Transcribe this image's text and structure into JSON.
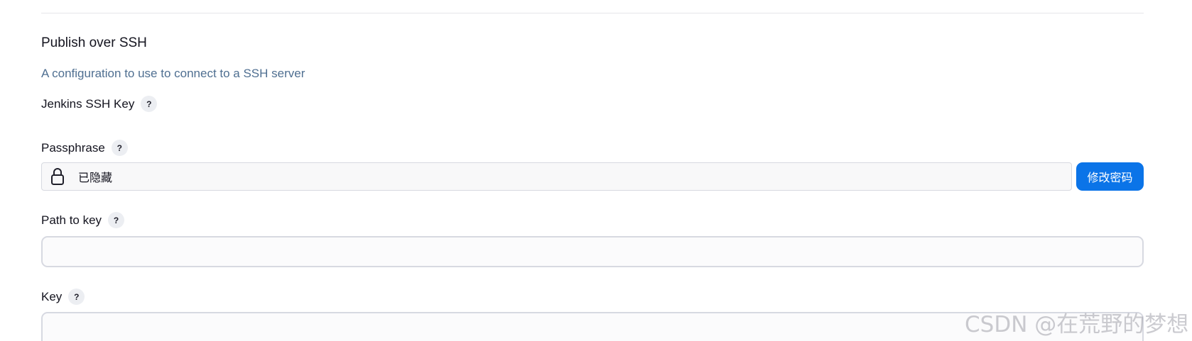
{
  "section": {
    "title": "Publish over SSH",
    "description": "A configuration to use to connect to a SSH server"
  },
  "fields": {
    "jenkins_ssh_key": {
      "label": "Jenkins SSH Key",
      "help": "?"
    },
    "passphrase": {
      "label": "Passphrase",
      "help": "?",
      "hidden_value": "已隐藏",
      "change_button": "修改密码",
      "icon": "lock-icon"
    },
    "path_to_key": {
      "label": "Path to key",
      "help": "?",
      "value": ""
    },
    "key": {
      "label": "Key",
      "help": "?",
      "value": ""
    }
  },
  "colors": {
    "accent": "#0b74e8",
    "description": "#4f6f91",
    "border": "#d7d9e1"
  },
  "watermark": "CSDN @在荒野的梦想"
}
